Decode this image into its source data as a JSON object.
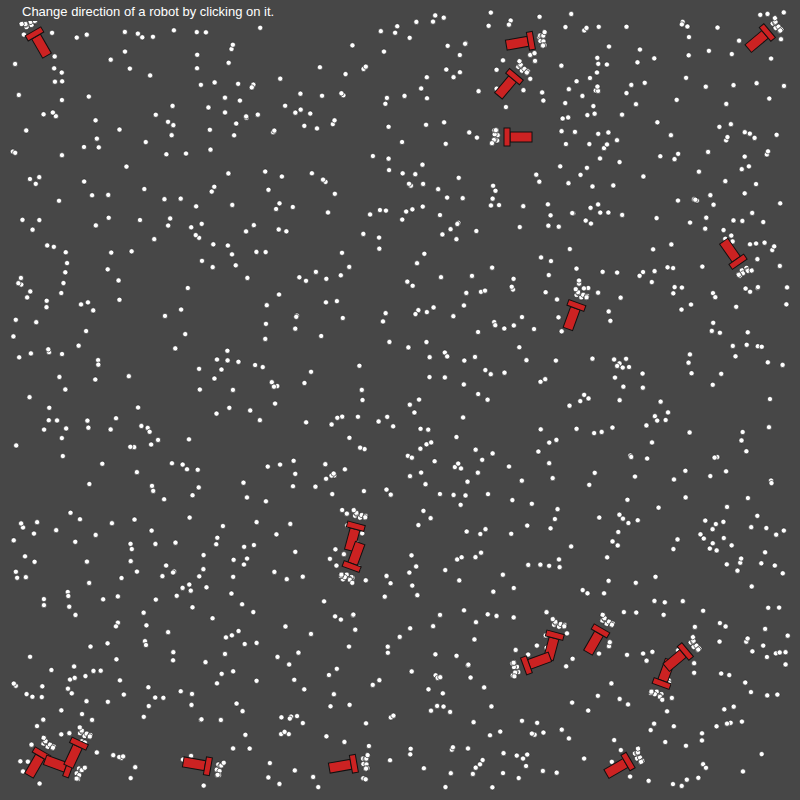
{
  "canvas": {
    "instruction": "Change direction of a robot by clicking on it."
  }
}
